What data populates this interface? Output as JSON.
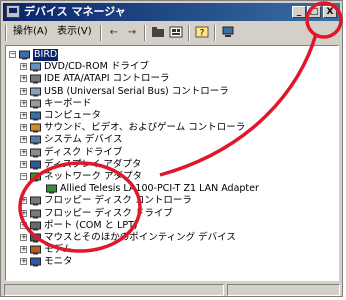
{
  "window": {
    "title": "デバイス マネージャ"
  },
  "title_buttons": {
    "minimize": "_",
    "maximize": "□",
    "close": "X"
  },
  "menu": {
    "action": "操作(A)",
    "view": "表示(V)"
  },
  "tree": {
    "root": "BIRD",
    "items": [
      {
        "label": "DVD/CD-ROM ドライブ",
        "icon": "cdrom-icon"
      },
      {
        "label": "IDE ATA/ATAPI コントローラ",
        "icon": "ide-controller-icon"
      },
      {
        "label": "USB (Universal Serial Bus) コントローラ",
        "icon": "usb-icon"
      },
      {
        "label": "キーボード",
        "icon": "keyboard-icon"
      },
      {
        "label": "コンピュータ",
        "icon": "computer-icon"
      },
      {
        "label": "サウンド、ビデオ、およびゲーム コントローラ",
        "icon": "sound-icon"
      },
      {
        "label": "システム デバイス",
        "icon": "system-device-icon"
      },
      {
        "label": "ディスク ドライブ",
        "icon": "disk-drive-icon"
      },
      {
        "label": "ディスプレイ アダプタ",
        "icon": "display-adapter-icon"
      },
      {
        "label": "ネットワーク アダプタ",
        "icon": "network-adapter-icon",
        "expanded": true
      },
      {
        "label": "Allied Telesis LA100-PCI-T Z1 LAN Adapter",
        "icon": "nic-icon",
        "child": true
      },
      {
        "label": "フロッピー ディスク コントローラ",
        "icon": "floppy-controller-icon"
      },
      {
        "label": "フロッピー ディスク ドライブ",
        "icon": "floppy-drive-icon"
      },
      {
        "label": "ポート (COM と LPT)",
        "icon": "port-icon"
      },
      {
        "label": "マウスとそのほかのポインティング デバイス",
        "icon": "mouse-icon"
      },
      {
        "label": "モデム",
        "icon": "modem-icon"
      },
      {
        "label": "モニタ",
        "icon": "monitor-icon"
      }
    ]
  },
  "colors": {
    "title_start": "#0a246a",
    "title_end": "#3a6ea5",
    "annotation": "#e0162b"
  }
}
